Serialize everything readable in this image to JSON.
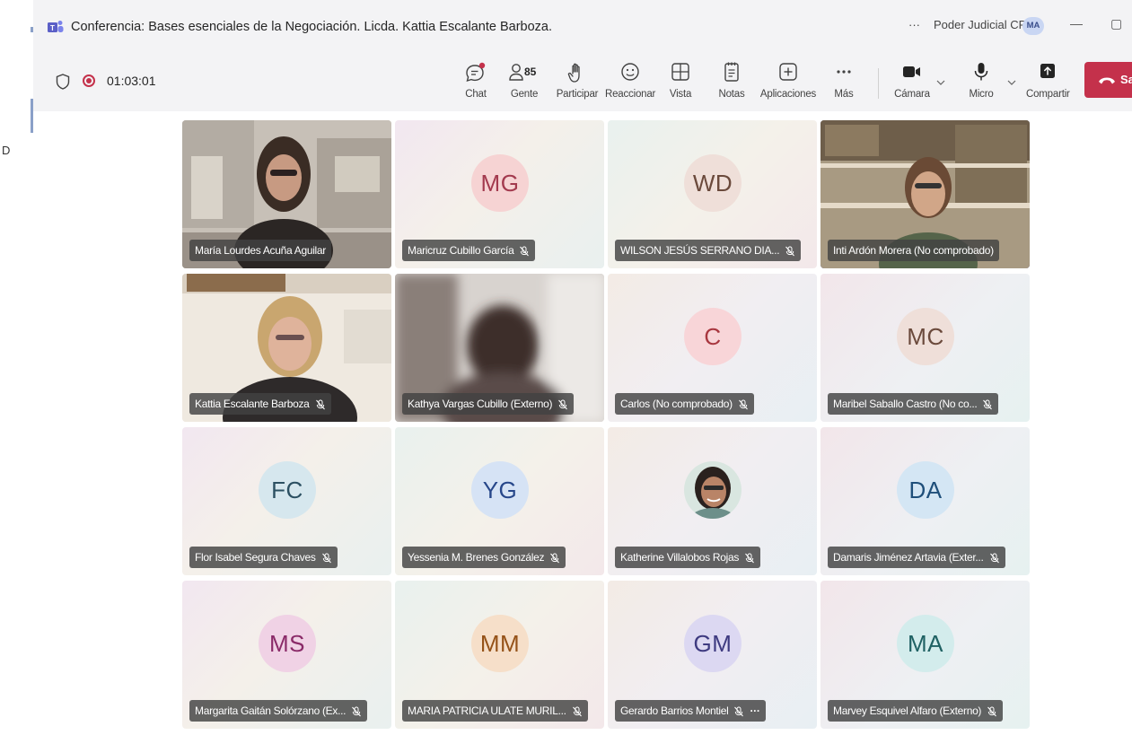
{
  "window": {
    "title": "Conferencia: Bases esenciales de la Negociación. Licda. Kattia Escalante Barboza.",
    "more": "···",
    "org": "Poder Judicial CR",
    "org_avatar": "MA",
    "minimize": "—",
    "maximize": "▢"
  },
  "left_panel": {
    "letter": "D"
  },
  "meeting": {
    "timer": "01:03:01"
  },
  "toolbar": {
    "chat": "Chat",
    "people": "Gente",
    "people_count": "85",
    "raise": "Participar",
    "react": "Reaccionar",
    "view": "Vista",
    "notes": "Notas",
    "apps": "Aplicaciones",
    "more": "Más",
    "camera": "Cámara",
    "mic": "Micro",
    "share": "Compartir",
    "leave": "Sa"
  },
  "accent_colors": {
    "leave": "#c4314b",
    "active_speaker": "#5b5fc7",
    "recording": "#c4314b"
  },
  "participants": [
    {
      "name": "María Lourdes Acuña Aguilar",
      "type": "video",
      "muted": false
    },
    {
      "name": "Maricruz Cubillo García",
      "initials": "MG",
      "muted": true,
      "avatar_bg": "#f6d3d3",
      "avatar_fg": "#a33a4e"
    },
    {
      "name": "WILSON JESÚS SERRANO DIA...",
      "initials": "WD",
      "muted": true,
      "avatar_bg": "#efdfd9",
      "avatar_fg": "#6b4a3c"
    },
    {
      "name": "Inti Ardón Morera (No comprobado)",
      "type": "video",
      "muted": false,
      "active": true
    },
    {
      "name": "Kattia Escalante Barboza",
      "type": "video",
      "muted": true
    },
    {
      "name": "Kathya Vargas Cubillo (Externo)",
      "type": "video",
      "muted": true
    },
    {
      "name": "Carlos (No comprobado)",
      "initials": "C",
      "muted": true,
      "avatar_bg": "#f8d5d8",
      "avatar_fg": "#a8373f"
    },
    {
      "name": "Maribel Saballo Castro (No co...",
      "initials": "MC",
      "muted": true,
      "avatar_bg": "#efdfd9",
      "avatar_fg": "#6b4a3c"
    },
    {
      "name": "Flor Isabel Segura Chaves",
      "initials": "FC",
      "muted": true,
      "avatar_bg": "#d6e7ee",
      "avatar_fg": "#2c5062"
    },
    {
      "name": "Yessenia M. Brenes González",
      "initials": "YG",
      "muted": true,
      "avatar_bg": "#d6e3f5",
      "avatar_fg": "#27478a"
    },
    {
      "name": "Katherine Villalobos Rojas",
      "type": "photo",
      "muted": true
    },
    {
      "name": "Damaris Jiménez Artavia (Exter...",
      "initials": "DA",
      "muted": true,
      "avatar_bg": "#d4e6f4",
      "avatar_fg": "#1f4f7a"
    },
    {
      "name": "Margarita Gaitán Solórzano (Ex...",
      "initials": "MS",
      "muted": true,
      "avatar_bg": "#f0d2e5",
      "avatar_fg": "#8a2a68"
    },
    {
      "name": "MARIA PATRICIA ULATE MURIL...",
      "initials": "MM",
      "muted": true,
      "avatar_bg": "#f6dfc9",
      "avatar_fg": "#955218"
    },
    {
      "name": "Gerardo Barrios Montiel",
      "initials": "GM",
      "muted": true,
      "more": "···",
      "avatar_bg": "#dcd8f2",
      "avatar_fg": "#3e3a80"
    },
    {
      "name": "Marvey Esquivel Alfaro (Externo)",
      "initials": "MA",
      "muted": true,
      "avatar_bg": "#d3ecec",
      "avatar_fg": "#1f6163"
    }
  ]
}
